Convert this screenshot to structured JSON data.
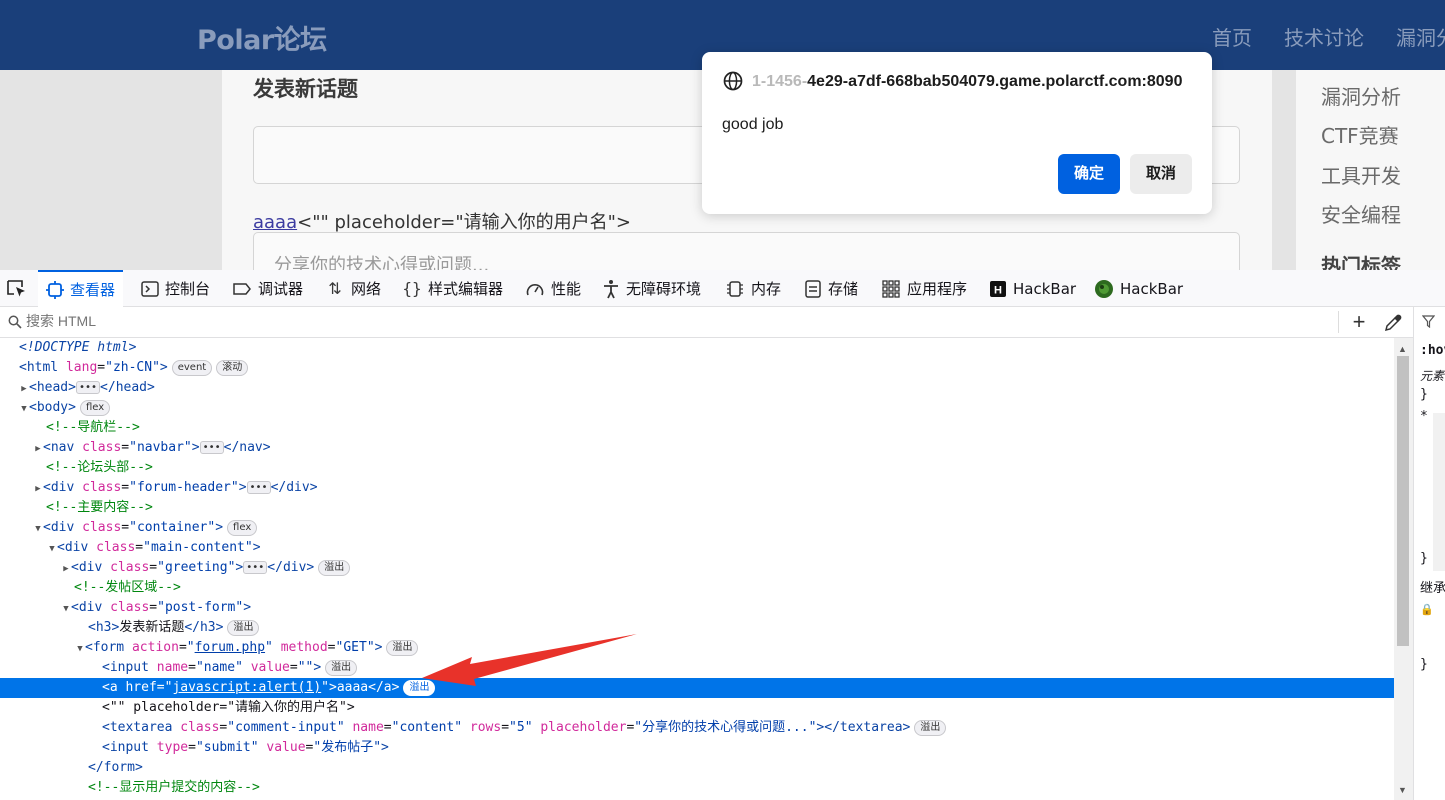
{
  "site": {
    "brand": "Polar论坛",
    "nav": [
      "首页",
      "技术讨论",
      "漏洞分"
    ],
    "post_title": "发表新话题",
    "xss_link_text": "aaaa",
    "xss_trailing_text": "<\"\" placeholder=\"请输入你的用户名\">",
    "content_placeholder": "分享你的技术心得或问题...",
    "sidebar_items": [
      "漏洞分析",
      "CTF竞赛",
      "工具开发",
      "安全编程"
    ],
    "sidebar_heading": "热门标签"
  },
  "dialog": {
    "origin_faded": "1-1456-",
    "origin": "4e29-a7df-668bab504079.game.polarctf.com:8090",
    "message": "good job",
    "ok_label": "确定",
    "cancel_label": "取消"
  },
  "devtools": {
    "tabs": [
      {
        "icon": "inspector-icon",
        "label": "查看器"
      },
      {
        "icon": "console-icon",
        "label": "控制台"
      },
      {
        "icon": "debugger-icon",
        "label": "调试器"
      },
      {
        "icon": "network-icon",
        "label": "网络"
      },
      {
        "icon": "style-editor-icon",
        "label": "样式编辑器"
      },
      {
        "icon": "performance-icon",
        "label": "性能"
      },
      {
        "icon": "accessibility-icon",
        "label": "无障碍环境"
      },
      {
        "icon": "memory-icon",
        "label": "内存"
      },
      {
        "icon": "storage-icon",
        "label": "存储"
      },
      {
        "icon": "application-icon",
        "label": "应用程序"
      },
      {
        "icon": "hackbar-icon",
        "label": "HackBar"
      },
      {
        "icon": "hackbar-green-icon",
        "label": "HackBar"
      }
    ],
    "search_placeholder": "搜索 HTML",
    "badges": {
      "event": "event",
      "scroll": "滚动",
      "flex": "flex",
      "overflow": "溢出"
    },
    "tree": {
      "doctype": "<!DOCTYPE html>",
      "html_tag": "html",
      "lang_attr": "lang",
      "lang_val": "zh-CN",
      "head_tag": "head",
      "body_tag": "body",
      "comment_nav": "<!--导航栏-->",
      "nav_tag": "nav",
      "class_attr": "class",
      "navbar_val": "navbar",
      "comment_header": "<!--论坛头部-->",
      "div_tag": "div",
      "forum_header_val": "forum-header",
      "comment_main": "<!--主要内容-->",
      "container_val": "container",
      "main_content_val": "main-content",
      "greeting_val": "greeting",
      "comment_post": "<!--发帖区域-->",
      "post_form_val": "post-form",
      "h3_text": "发表新话题",
      "form_tag": "form",
      "action_attr": "action",
      "action_val": "forum.php",
      "method_attr": "method",
      "method_val": "GET",
      "input_tag": "input",
      "name_attr": "name",
      "name_val": "name",
      "value_attr": "value",
      "a_tag": "a",
      "href_attr": "href",
      "href_val": "javascript:alert(1)",
      "a_text": "aaaa",
      "text_node": "<\"\" placeholder=\"请输入你的用户名\">",
      "textarea_tag": "textarea",
      "comment_input_val": "comment-input",
      "content_val": "content",
      "rows_attr": "rows",
      "rows_val": "5",
      "placeholder_attr": "placeholder",
      "placeholder_val": "分享你的技术心得或问题...",
      "type_attr": "type",
      "submit_val": "submit",
      "submit_value": "发布帖子",
      "comment_show": "<!--显示用户提交的内容-->"
    },
    "rules_panel": {
      "hov": ":hov",
      "element": "元素",
      "brace_close": "}",
      "star": "*",
      "inherit": "继承"
    }
  },
  "colors": {
    "accent": "#0061e0",
    "navbar": "#1a3f7a",
    "selection": "#0074e8",
    "arrow": "#e8322a"
  }
}
